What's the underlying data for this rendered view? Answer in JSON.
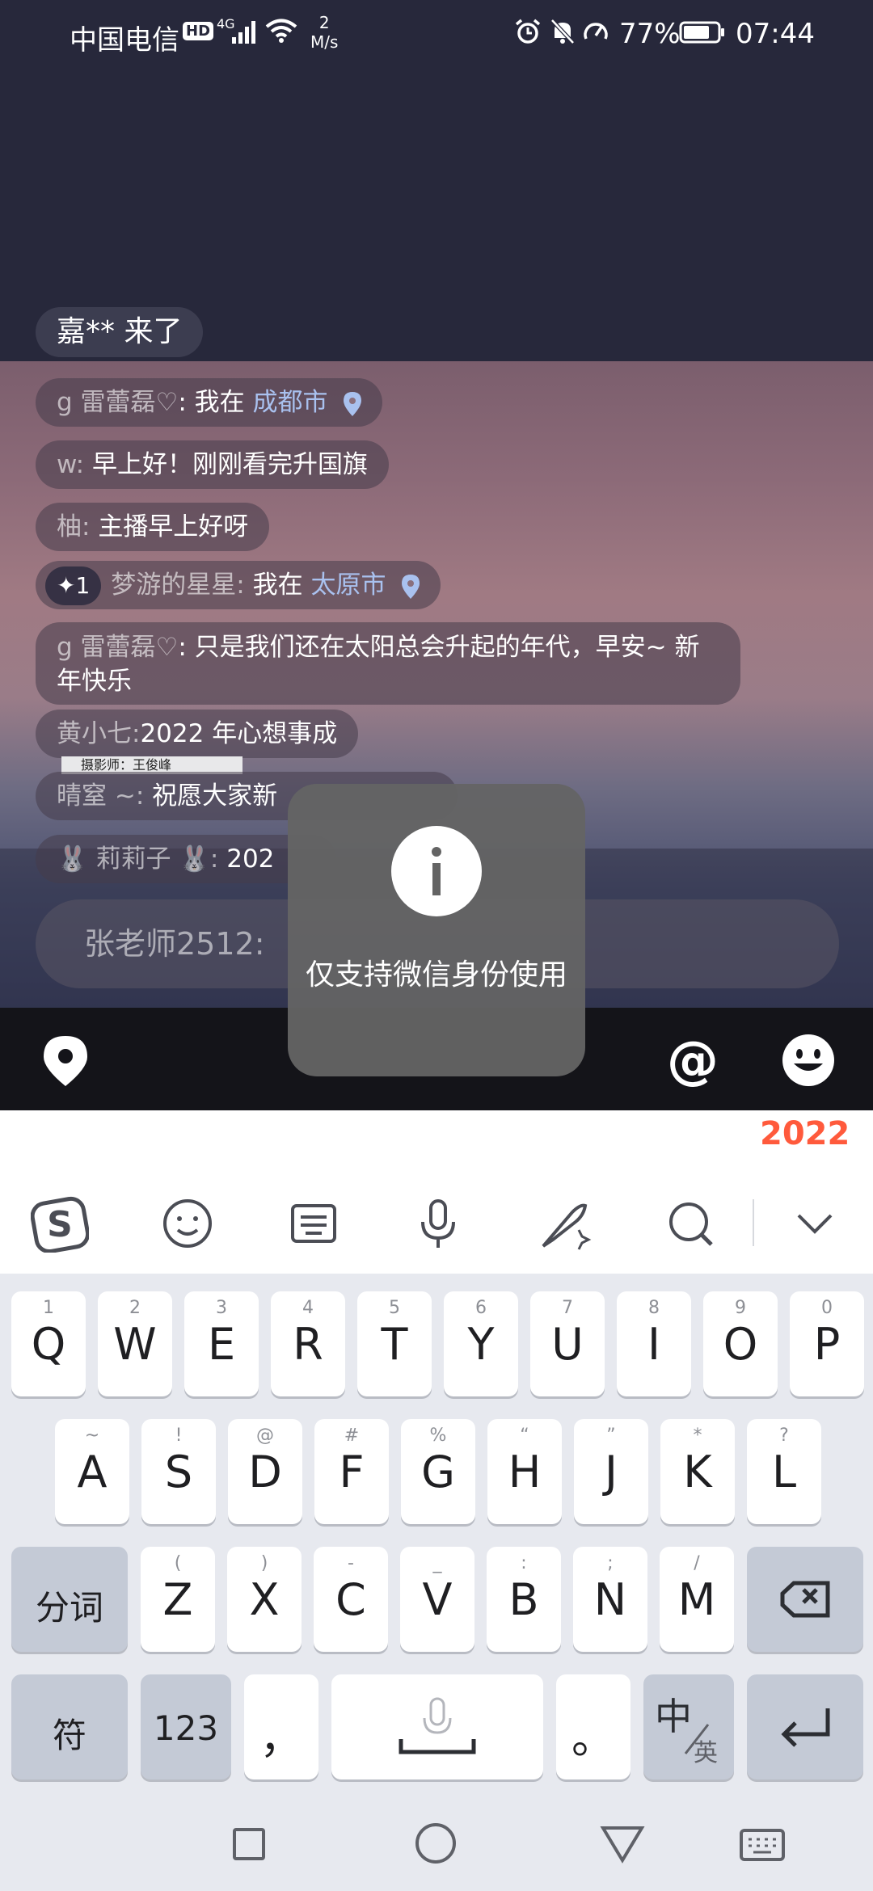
{
  "status_bar": {
    "carrier": "中国电信",
    "hd": "HD",
    "network_type": "4G",
    "speed_value": "2",
    "speed_unit": "M/s",
    "battery": "77%",
    "time": "07:44"
  },
  "enter_notice": "嘉** 来了",
  "chat": [
    {
      "user": "g 雷蕾磊♡",
      "text": "我在 ",
      "location": "成都市"
    },
    {
      "user": "w:",
      "text": "早上好！刚刚看完升国旗"
    },
    {
      "user": "柚:",
      "text": "主播早上好呀"
    },
    {
      "badge": "✦1",
      "user": "梦游的星星:",
      "text": "我在 ",
      "location": "太原市"
    },
    {
      "user": "g 雷蕾磊♡",
      "text": "只是我们还在太阳总会升起的年代，早安~ 新年快乐"
    },
    {
      "user": "黄小七:",
      "text": "2022 年心想事成"
    },
    {
      "user": "晴窒 ~:",
      "text": "祝愿大家新"
    },
    {
      "user": "🐰 莉莉子 🐰:",
      "text": "202"
    }
  ],
  "photo_credit": "摄影师：王俊峰",
  "input": {
    "placeholder": "张老师2512:"
  },
  "toast": {
    "text": "仅支持微信身份使用"
  },
  "keyboard_badge": "2022",
  "keyboard": {
    "row1": [
      {
        "sub": "1",
        "main": "Q"
      },
      {
        "sub": "2",
        "main": "W"
      },
      {
        "sub": "3",
        "main": "E"
      },
      {
        "sub": "4",
        "main": "R"
      },
      {
        "sub": "5",
        "main": "T"
      },
      {
        "sub": "6",
        "main": "Y"
      },
      {
        "sub": "7",
        "main": "U"
      },
      {
        "sub": "8",
        "main": "I"
      },
      {
        "sub": "9",
        "main": "O"
      },
      {
        "sub": "0",
        "main": "P"
      }
    ],
    "row2": [
      {
        "sub": "~",
        "main": "A"
      },
      {
        "sub": "!",
        "main": "S"
      },
      {
        "sub": "@",
        "main": "D"
      },
      {
        "sub": "#",
        "main": "F"
      },
      {
        "sub": "%",
        "main": "G"
      },
      {
        "sub": "“",
        "main": "H"
      },
      {
        "sub": "”",
        "main": "J"
      },
      {
        "sub": "*",
        "main": "K"
      },
      {
        "sub": "?",
        "main": "L"
      }
    ],
    "row3": [
      {
        "sub": "(",
        "main": "Z"
      },
      {
        "sub": ")",
        "main": "X"
      },
      {
        "sub": "-",
        "main": "C"
      },
      {
        "sub": "_",
        "main": "V"
      },
      {
        "sub": ":",
        "main": "B"
      },
      {
        "sub": ";",
        "main": "N"
      },
      {
        "sub": "/",
        "main": "M"
      }
    ],
    "fenci": "分词",
    "symbols": "符",
    "numbers": "123",
    "comma": "，",
    "period": "。",
    "lang_main": "中",
    "lang_sub": "英"
  }
}
